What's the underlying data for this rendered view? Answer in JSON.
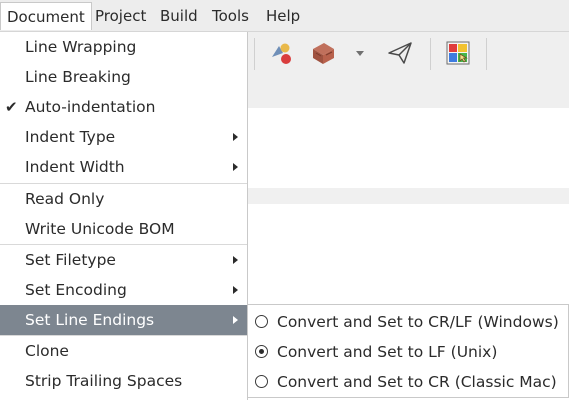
{
  "menubar": {
    "items": [
      "Document",
      "Project",
      "Build",
      "Tools",
      "Help"
    ]
  },
  "toolbar": {
    "icons": [
      "compile-shapes-icon",
      "build-brick-icon",
      "dropdown-arrow-icon",
      "send-paper-plane-icon",
      "color-chooser-icon"
    ]
  },
  "document_menu": {
    "items": [
      {
        "label": "Line Wrapping"
      },
      {
        "label": "Line Breaking"
      },
      {
        "label": "Auto-indentation",
        "checked": true,
        "check_glyph": "✔"
      },
      {
        "label": "Indent Type",
        "submenu": true
      },
      {
        "label": "Indent Width",
        "submenu": true
      },
      {
        "label": "Read Only"
      },
      {
        "label": "Write Unicode BOM"
      },
      {
        "label": "Set Filetype",
        "submenu": true
      },
      {
        "label": "Set Encoding",
        "submenu": true
      },
      {
        "label": "Set Line Endings",
        "submenu": true,
        "highlighted": true
      },
      {
        "label": "Clone"
      },
      {
        "label": "Strip Trailing Spaces"
      }
    ]
  },
  "line_endings_submenu": {
    "items": [
      {
        "label": "Convert and Set to CR/LF (Windows)",
        "selected": false
      },
      {
        "label": "Convert and Set to LF (Unix)",
        "selected": true
      },
      {
        "label": "Convert and Set to CR (Classic Mac)",
        "selected": false
      }
    ]
  },
  "colors": {
    "highlight": "#7d8690",
    "menubar_bg": "#ededed"
  }
}
